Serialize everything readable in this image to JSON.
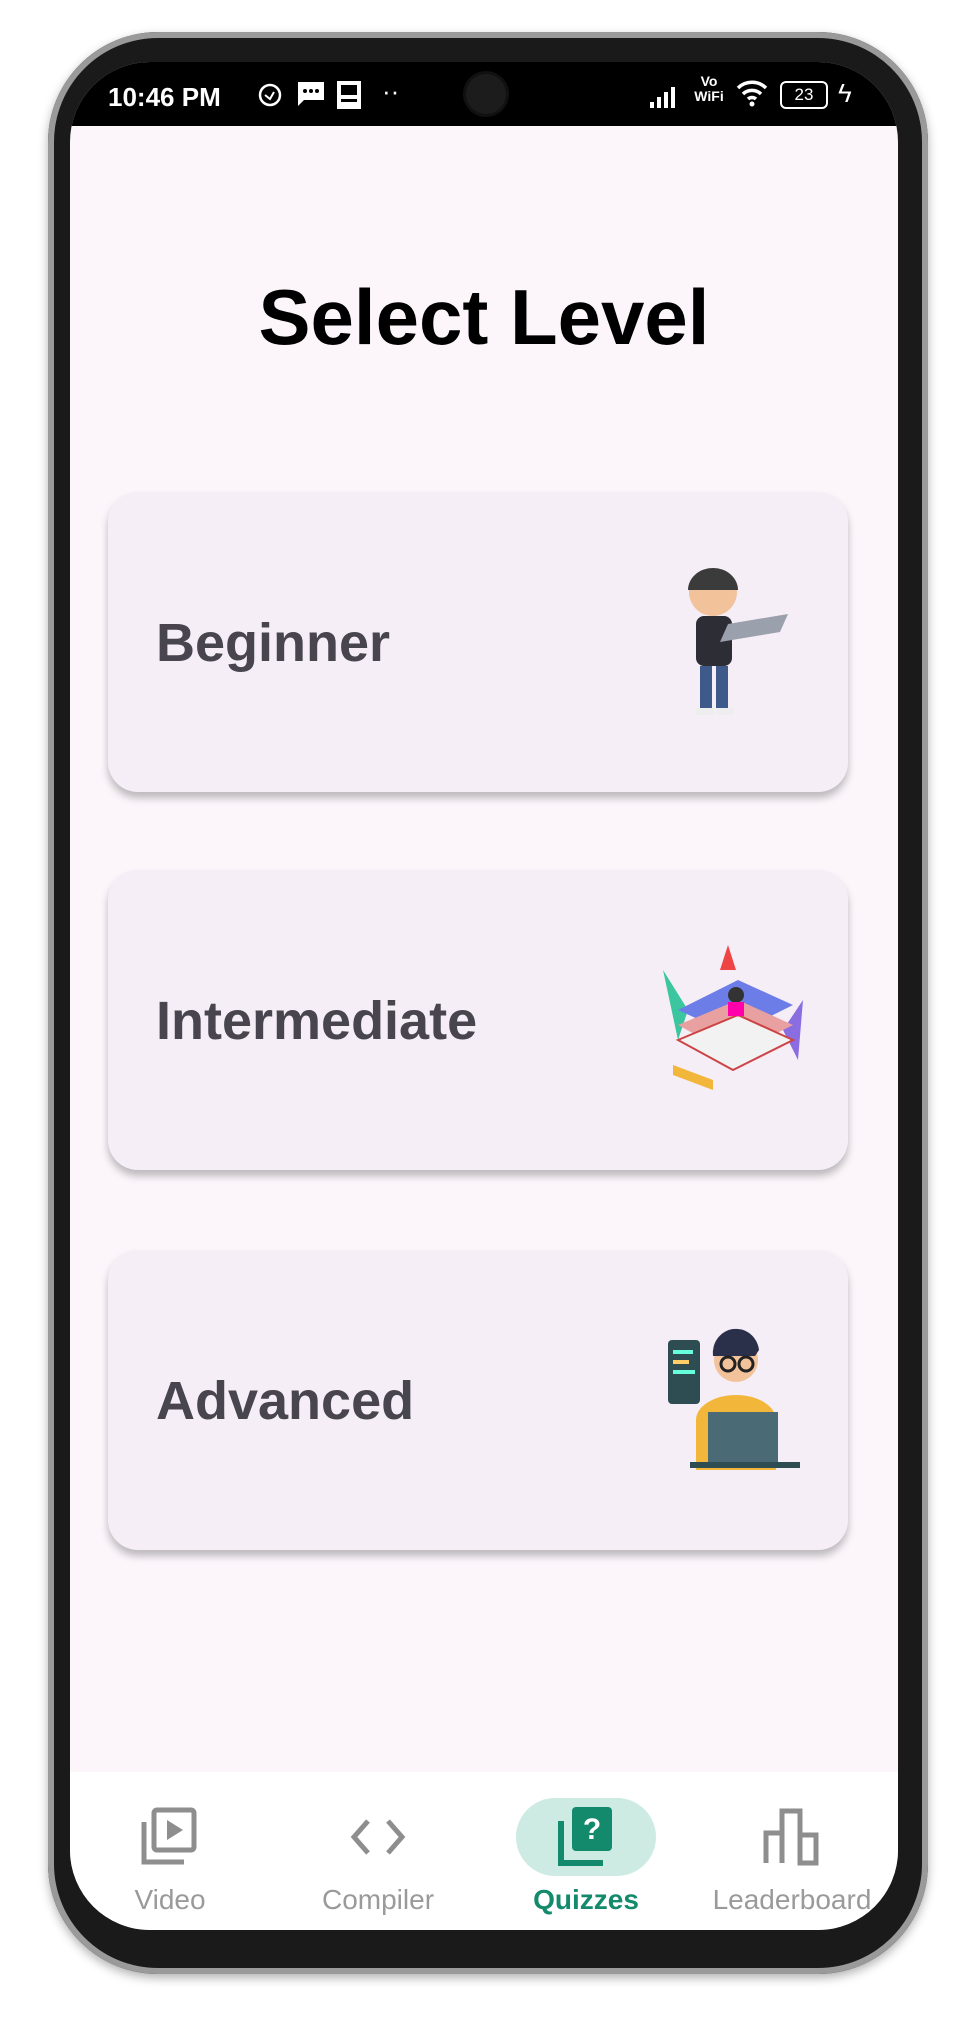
{
  "status_bar": {
    "time": "10:46 PM",
    "battery": "23",
    "network": "Vo WiFi"
  },
  "page": {
    "title": "Select Level"
  },
  "levels": [
    {
      "label": "Beginner"
    },
    {
      "label": "Intermediate"
    },
    {
      "label": "Advanced"
    }
  ],
  "nav": {
    "items": [
      {
        "label": "Video"
      },
      {
        "label": "Compiler"
      },
      {
        "label": "Quizzes"
      },
      {
        "label": "Leaderboard"
      }
    ],
    "active": "Quizzes"
  },
  "colors": {
    "accent": "#148a6c",
    "pill": "#cdebe3",
    "card": "#f5eef7",
    "background": "#fcf6fb"
  }
}
